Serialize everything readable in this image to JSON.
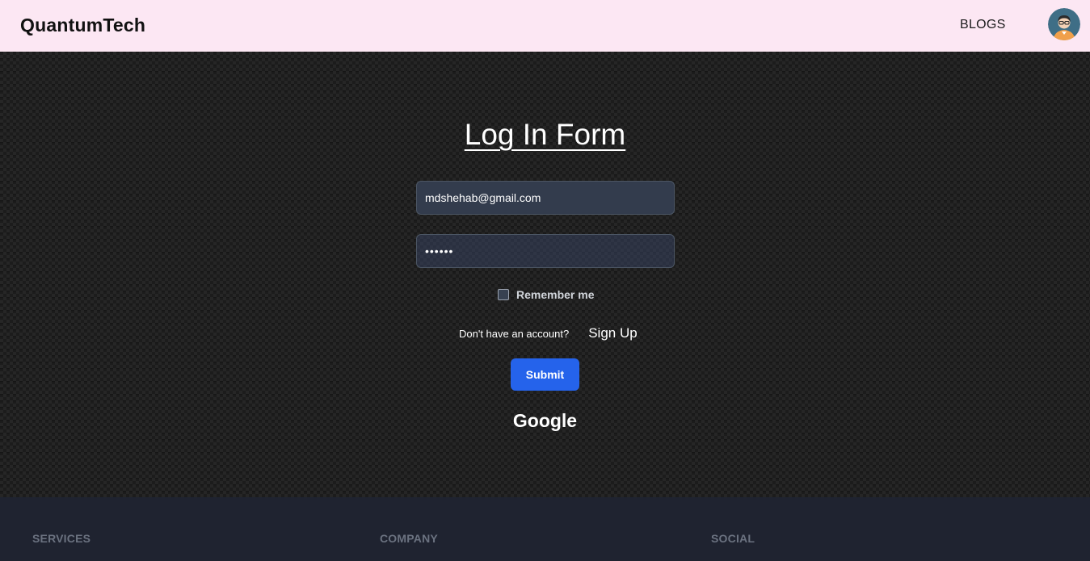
{
  "navbar": {
    "brand": "QuantumTech",
    "links": [
      {
        "label": "BLOGS"
      }
    ]
  },
  "login": {
    "title": "Log In Form",
    "email_value": "mdshehab@gmail.com",
    "password_value": "••••••",
    "remember_label": "Remember me",
    "account_prompt": "Don't have an account?",
    "signup_label": "Sign Up",
    "submit_label": "Submit",
    "google_label": "Google"
  },
  "footer": {
    "headings": [
      {
        "label": "SERVICES"
      },
      {
        "label": "COMPANY"
      },
      {
        "label": "SOCIAL"
      }
    ]
  },
  "colors": {
    "navbar_bg": "#fce7f3",
    "accent": "#2563eb",
    "footer_bg": "#1f2330"
  }
}
